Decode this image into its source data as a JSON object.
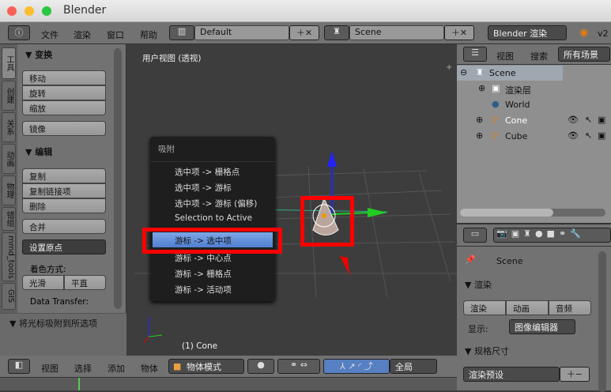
{
  "window": {
    "title": "Blender"
  },
  "top_header": {
    "menus": [
      "文件",
      "渲染",
      "窗口",
      "帮助"
    ],
    "layout": "Default",
    "scene": "Scene",
    "engine": "Blender 渲染",
    "version": "v2"
  },
  "tool_shelf": {
    "tabs": [
      "工具",
      "创建",
      "关系",
      "动画",
      "物理",
      "错组",
      "mmd_tools",
      "GIS"
    ],
    "transform": {
      "title": "▼ 变换",
      "buttons": [
        "移动",
        "旋转",
        "缩放"
      ],
      "mirror": "镜像"
    },
    "edit": {
      "title": "▼ 编辑",
      "buttons": [
        "复制",
        "复制链接项",
        "删除"
      ],
      "join": "合并",
      "set_origin": "设置原点",
      "shading_label": "着色方式:",
      "smooth": "光滑",
      "flat": "平直",
      "data_transfer": "Data Transfer:"
    },
    "operator_panel": "▼ 将光标吸附到所选项"
  },
  "viewport": {
    "label": "用户视图 (透视)",
    "object_label": "(1) Cone"
  },
  "snap_menu": {
    "title": "吸附",
    "items": [
      "选中项 -> 栅格点",
      "选中项 -> 游标",
      "选中项 -> 游标 (偏移)",
      "Selection to Active",
      "游标 -> 选中项",
      "游标 -> 中心点",
      "游标 -> 栅格点",
      "游标 -> 活动项"
    ],
    "highlighted": "游标 -> 选中项"
  },
  "outliner": {
    "menus": [
      "视图",
      "搜索"
    ],
    "filter": "所有场景",
    "items": [
      "Scene",
      "渲染层",
      "World",
      "Cone",
      "Cube"
    ]
  },
  "properties": {
    "scene": "Scene",
    "render_title": "▼ 渲染",
    "render_btn": "渲染",
    "anim_btn": "动画",
    "audio_btn": "音频",
    "display_label": "显示:",
    "display_value": "图像编辑器",
    "dimensions_title": "▼ 规格尺寸",
    "preset": "渲染预设"
  },
  "bottom_header": {
    "menus": [
      "视图",
      "选择",
      "添加",
      "物体"
    ],
    "mode": "物体模式",
    "orientation": "全局"
  },
  "colors": {
    "highlight": "#f00000",
    "menu_selected": "#5a8ad8",
    "accent_blue": "#5680c2"
  }
}
